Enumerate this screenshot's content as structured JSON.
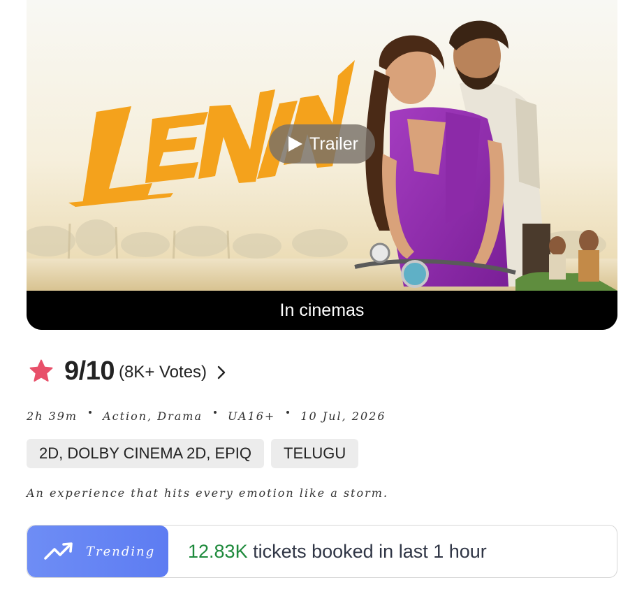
{
  "poster": {
    "title_art": "LENIN",
    "trailer_label": "Trailer",
    "status_bar": "In cinemas"
  },
  "rating": {
    "value": "9/10",
    "votes": "(8K+ Votes)"
  },
  "meta": {
    "duration": "2h 39m",
    "genres": "Action, Drama",
    "certificate": "UA16+",
    "release_date": "10 Jul, 2026"
  },
  "chips": {
    "formats": "2D, DOLBY CINEMA 2D, EPIQ",
    "language": "TELUGU"
  },
  "tagline": "An experience that hits every emotion like a storm.",
  "trending": {
    "badge_label": "Trending",
    "count": "12.83K",
    "text": " tickets booked in last 1 hour"
  },
  "colors": {
    "star": "#e8506a",
    "trending_badge": "#5d7cf2",
    "count_green": "#1e8a3c",
    "title_art": "#f4a21c"
  },
  "icons": [
    "play-icon",
    "star-icon",
    "chevron-right-icon",
    "trend-up-icon"
  ]
}
